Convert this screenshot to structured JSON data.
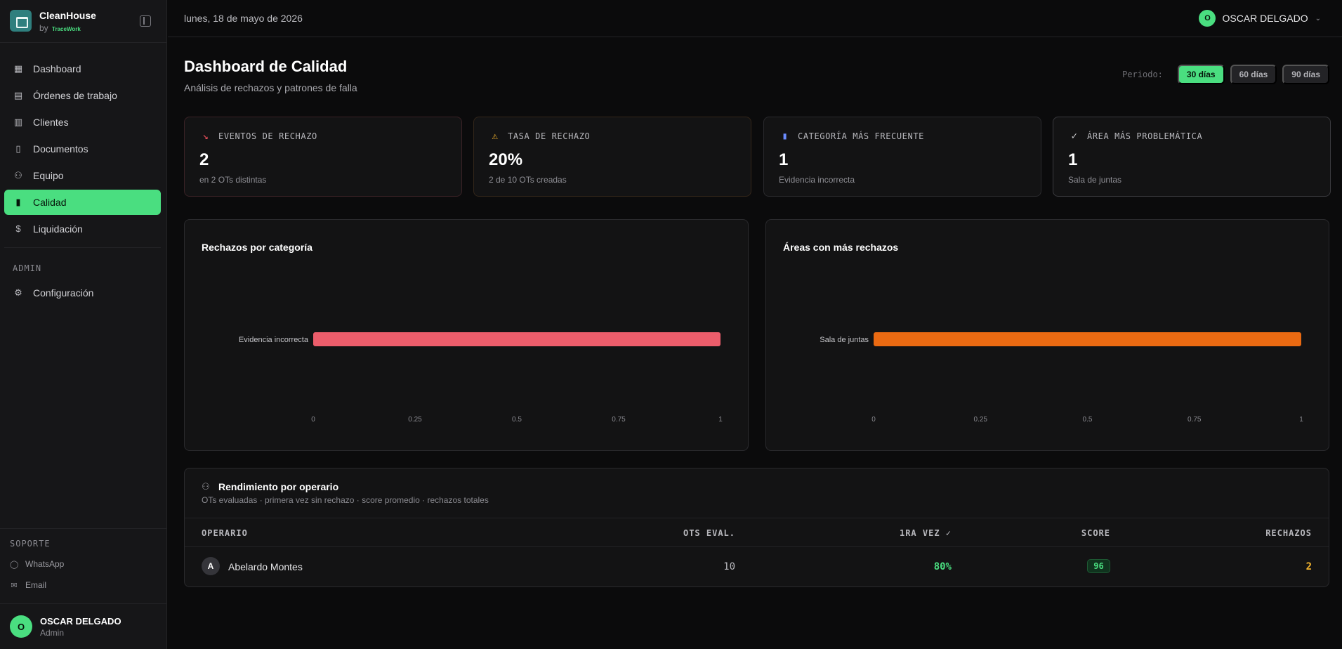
{
  "brand": {
    "name": "CleanHouse",
    "by": "by",
    "partner": "TraceWork"
  },
  "nav": [
    {
      "label": "Dashboard",
      "icon": "grid-icon",
      "glyph": "▦",
      "active": false
    },
    {
      "label": "Órdenes de trabajo",
      "icon": "clipboard-icon",
      "glyph": "▤",
      "active": false
    },
    {
      "label": "Clientes",
      "icon": "building-icon",
      "glyph": "▥",
      "active": false
    },
    {
      "label": "Documentos",
      "icon": "document-icon",
      "glyph": "▯",
      "active": false
    },
    {
      "label": "Equipo",
      "icon": "users-icon",
      "glyph": "⚇",
      "active": false
    },
    {
      "label": "Calidad",
      "icon": "bar-chart-icon",
      "glyph": "▮",
      "active": true
    },
    {
      "label": "Liquidación",
      "icon": "dollar-icon",
      "glyph": "$",
      "active": false
    }
  ],
  "admin": {
    "label": "ADMIN",
    "items": [
      {
        "label": "Configuración",
        "icon": "gear-icon",
        "glyph": "⚙"
      }
    ]
  },
  "support": {
    "label": "SOPORTE",
    "items": [
      {
        "label": "WhatsApp",
        "icon": "chat-icon",
        "glyph": "◯"
      },
      {
        "label": "Email",
        "icon": "mail-icon",
        "glyph": "✉"
      }
    ]
  },
  "user": {
    "initial": "O",
    "name": "OSCAR DELGADO",
    "role": "Admin"
  },
  "header": {
    "date": "lunes, 18 de mayo de 2026",
    "user_initial": "O",
    "user_name": "OSCAR DELGADO"
  },
  "page": {
    "title": "Dashboard de Calidad",
    "subtitle": "Análisis de rechazos y patrones de falla"
  },
  "period": {
    "label": "Periodo:",
    "options": [
      "30 días",
      "60 días",
      "90 días"
    ],
    "active": 0
  },
  "kpis": [
    {
      "label": "EVENTOS DE RECHAZO",
      "value": "2",
      "note": "en 2 OTs distintas",
      "icon": "trending-down-icon",
      "glyph": "↘",
      "color": "#f0505c"
    },
    {
      "label": "TASA DE RECHAZO",
      "value": "20%",
      "note": "2 de 10 OTs creadas",
      "icon": "warning-icon",
      "glyph": "⚠",
      "color": "#f5b52e"
    },
    {
      "label": "CATEGORÍA MÁS FRECUENTE",
      "value": "1",
      "note": "Evidencia incorrecta",
      "icon": "bar-chart-icon",
      "glyph": "▮",
      "color": "#6b8cff"
    },
    {
      "label": "ÁREA MÁS PROBLEMÁTICA",
      "value": "1",
      "note": "Sala de juntas",
      "icon": "check-circle-icon",
      "glyph": "✓",
      "color": "#c8c8cc"
    }
  ],
  "chart_data": [
    {
      "type": "bar",
      "orientation": "horizontal",
      "title": "Rechazos por categoría",
      "categories": [
        "Evidencia incorrecta"
      ],
      "values": [
        1
      ],
      "xlim": [
        0,
        1
      ],
      "ticks": [
        "0",
        "0.25",
        "0.5",
        "0.75",
        "1"
      ],
      "color": "#ec5d6b"
    },
    {
      "type": "bar",
      "orientation": "horizontal",
      "title": "Áreas con más rechazos",
      "categories": [
        "Sala de juntas"
      ],
      "values": [
        1
      ],
      "xlim": [
        0,
        1
      ],
      "ticks": [
        "0",
        "0.25",
        "0.5",
        "0.75",
        "1"
      ],
      "color": "#ea6a12"
    }
  ],
  "table": {
    "title": "Rendimiento por operario",
    "subtitle": "OTs evaluadas · primera vez sin rechazo · score promedio · rechazos totales",
    "columns": [
      "OPERARIO",
      "OTS EVAL.",
      "1RA VEZ ✓",
      "SCORE",
      "RECHAZOS"
    ],
    "rows": [
      {
        "initial": "A",
        "name": "Abelardo Montes",
        "ots": "10",
        "first": "80%",
        "score": "96",
        "rejects": "2"
      }
    ],
    "colors": {
      "first": "#4ade80",
      "rejects": "#f5b52e"
    }
  }
}
